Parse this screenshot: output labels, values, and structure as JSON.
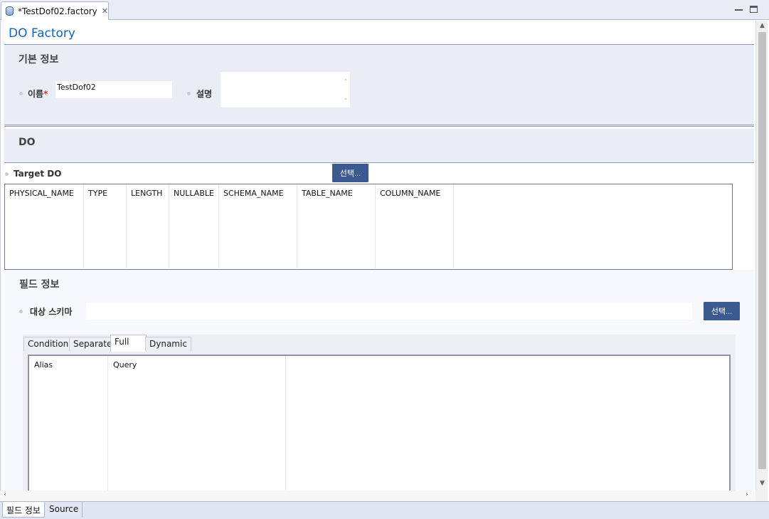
{
  "editor_tab": {
    "title": "*TestDof02.factory",
    "close_icon": "close-icon"
  },
  "form": {
    "title": "DO Factory"
  },
  "basic_info": {
    "title": "기본 정보",
    "name_label": "이름",
    "required_mark": "*",
    "name_value": "TestDof02",
    "description_label": "설명",
    "description_value": ""
  },
  "do_section": {
    "title": "DO",
    "target_label": "Target DO",
    "target_value": "",
    "select_button": "선택...",
    "columns": [
      "PHYSICAL_NAME",
      "TYPE",
      "LENGTH",
      "NULLABLE",
      "SCHEMA_NAME",
      "TABLE_NAME",
      "COLUMN_NAME"
    ]
  },
  "field_info": {
    "title": "필드 정보",
    "schema_label": "대상 스키마",
    "schema_value": "",
    "select_button": "선택...",
    "tabs": [
      "Condition",
      "Separate",
      "Full",
      "Dynamic"
    ],
    "active_tab": "Full",
    "columns": [
      "Alias",
      "Query"
    ]
  },
  "page_tabs": [
    "필드 정보",
    "Source"
  ],
  "active_page_tab": "필드 정보",
  "colors": {
    "title_blue": "#1565b6",
    "button_blue": "#3b5a8f",
    "section_bg": "#eaedf6"
  }
}
